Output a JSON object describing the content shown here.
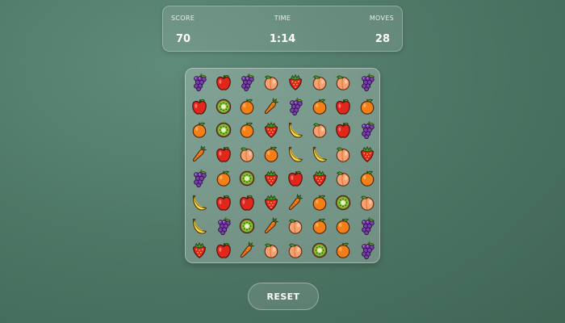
{
  "stats": {
    "score": {
      "label": "SCORE",
      "value": "70"
    },
    "time": {
      "label": "TIME",
      "value": "1:14"
    },
    "moves": {
      "label": "MOVES",
      "value": "28"
    }
  },
  "board": {
    "rows": [
      [
        "grape",
        "apple",
        "grape",
        "peach",
        "strawberry",
        "peach",
        "peach",
        "grape"
      ],
      [
        "apple",
        "kiwi",
        "orange",
        "carrot",
        "grape",
        "orange",
        "apple",
        "orange"
      ],
      [
        "orange",
        "kiwi",
        "orange",
        "strawberry",
        "banana",
        "peach",
        "apple",
        "grape"
      ],
      [
        "carrot",
        "apple",
        "peach",
        "orange",
        "banana",
        "banana",
        "peach",
        "strawberry"
      ],
      [
        "grape",
        "orange",
        "kiwi",
        "strawberry",
        "apple",
        "strawberry",
        "peach",
        "orange"
      ],
      [
        "banana",
        "apple",
        "apple",
        "strawberry",
        "carrot",
        "orange",
        "kiwi",
        "peach"
      ],
      [
        "banana",
        "grape",
        "kiwi",
        "carrot",
        "peach",
        "orange",
        "orange",
        "grape"
      ],
      [
        "strawberry",
        "apple",
        "carrot",
        "peach",
        "peach",
        "kiwi",
        "orange",
        "grape"
      ]
    ]
  },
  "reset_label": "RESET",
  "colors": {
    "background": "#4f7867",
    "text": "#ffffff"
  }
}
